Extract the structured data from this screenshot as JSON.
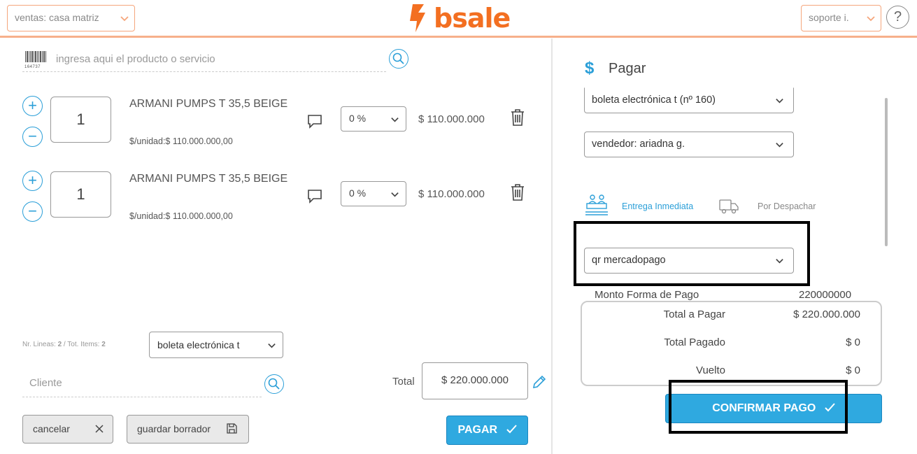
{
  "header": {
    "branch_select": "ventas: casa matriz",
    "logo_text": "bsale",
    "user_select": "soporte i.",
    "help_label": "?"
  },
  "search": {
    "placeholder": "ingresa aqui el producto o servicio",
    "barcode_text": "164737"
  },
  "items": [
    {
      "qty": "1",
      "name": "ARMANI PUMPS T 35,5 BEIGE",
      "unit_price": "$/unidad:$ 110.000.000,00",
      "discount": "0 %",
      "price": "$ 110.000.000"
    },
    {
      "qty": "1",
      "name": "ARMANI PUMPS T 35,5 BEIGE",
      "unit_price": "$/unidad:$ 110.000.000,00",
      "discount": "0 %",
      "price": "$ 110.000.000"
    }
  ],
  "footer": {
    "lines_label": "Nr. Lineas: ",
    "lines_value": "2",
    "items_label": " / Tot. Items: ",
    "items_value": "2",
    "document_select": "boleta electrónica t",
    "client_placeholder": "Cliente",
    "total_label": "Total",
    "total_value": "$ 220.000.000",
    "cancel_label": "cancelar",
    "draft_label": "guardar borrador",
    "pay_label": "PAGAR"
  },
  "payment": {
    "title": "Pagar",
    "document_select": "boleta electrónica t (nº 160)",
    "seller_select": "vendedor: ariadna g.",
    "delivery_immediate": "Entrega Inmediata",
    "delivery_dispatch": "Por Despachar",
    "method_select": "qr mercadopago",
    "amount_label": "Monto Forma de Pago",
    "amount_value": "220000000",
    "total_to_pay_label": "Total a Pagar",
    "total_to_pay_value": "$ 220.000.000",
    "total_paid_label": "Total Pagado",
    "total_paid_value": "$ 0",
    "change_label": "Vuelto",
    "change_value": "$ 0",
    "confirm_label": "CONFIRMAR PAGO"
  },
  "colors": {
    "brand_orange": "#f36f21",
    "accent_blue": "#2fa9e0"
  }
}
